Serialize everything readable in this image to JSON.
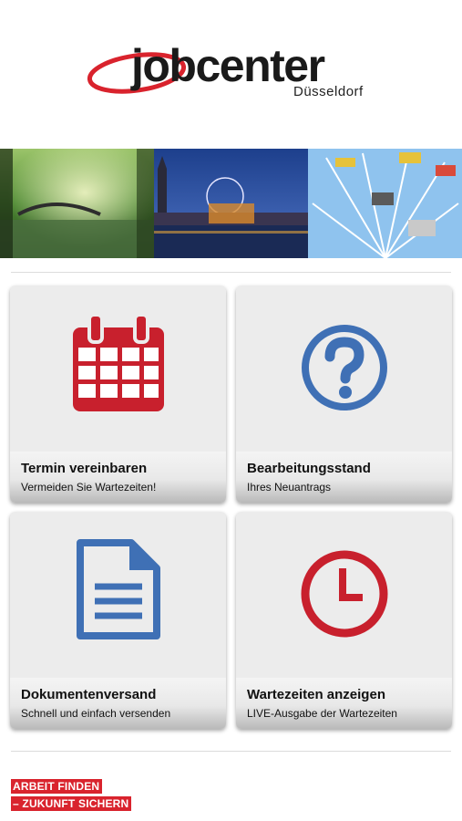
{
  "header": {
    "logo_word": "jobcenter",
    "logo_city": "Düsseldorf"
  },
  "banner": {
    "images": [
      "park-canal-photo",
      "city-night-ferris-wheel-photo",
      "swing-ride-photo"
    ]
  },
  "tiles": [
    {
      "title": "Termin vereinbaren",
      "subtitle": "Vermeiden Sie Wartezeiten!",
      "icon": "calendar-icon",
      "color": "#c8202d"
    },
    {
      "title": "Bearbeitungsstand",
      "subtitle": "Ihres Neuantrags",
      "icon": "question-icon",
      "color": "#3f70b5"
    },
    {
      "title": "Dokumentenversand",
      "subtitle": "Schnell und einfach versenden",
      "icon": "document-icon",
      "color": "#3f70b5"
    },
    {
      "title": "Wartezeiten anzeigen",
      "subtitle": "LIVE-Ausgabe der Wartezeiten",
      "icon": "clock-icon",
      "color": "#c8202d"
    }
  ],
  "footer": {
    "slogan_line1": "ARBEIT FINDEN",
    "slogan_line2": "– ZUKUNFT SICHERN"
  },
  "colors": {
    "brand_red": "#d9232d",
    "accent_blue": "#3f70b5"
  }
}
